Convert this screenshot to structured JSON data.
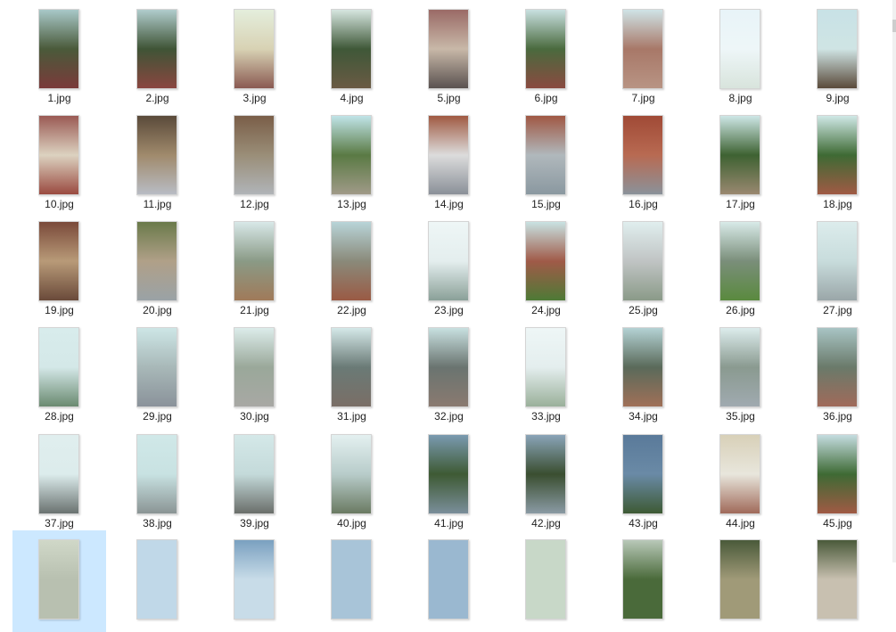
{
  "files": [
    {
      "name": "1.jpg",
      "top": "#a8c8c8",
      "mid": "#4a5a3a",
      "bottom": "#7a3a3a"
    },
    {
      "name": "2.jpg",
      "top": "#b0cccc",
      "mid": "#3f5436",
      "bottom": "#8a4640"
    },
    {
      "name": "3.jpg",
      "top": "#e4eedc",
      "mid": "#d8d2b4",
      "bottom": "#8a5a52"
    },
    {
      "name": "4.jpg",
      "top": "#d6e6e0",
      "mid": "#3f5838",
      "bottom": "#6a5a44"
    },
    {
      "name": "5.jpg",
      "top": "#9a6a66",
      "mid": "#c8b8a8",
      "bottom": "#5a5250"
    },
    {
      "name": "6.jpg",
      "top": "#c8e0e0",
      "mid": "#4a6a3e",
      "bottom": "#8a4a40"
    },
    {
      "name": "7.jpg",
      "top": "#cfe3e6",
      "mid": "#a87868",
      "bottom": "#b89484"
    },
    {
      "name": "8.jpg",
      "top": "#e8f4f8",
      "mid": "#eef6f8",
      "bottom": "#d8e4dc"
    },
    {
      "name": "9.jpg",
      "top": "#c8e2e6",
      "mid": "#cfe4e4",
      "bottom": "#5a4a3a"
    },
    {
      "name": "10.jpg",
      "top": "#9a5a54",
      "mid": "#dcd2c0",
      "bottom": "#9a4a40"
    },
    {
      "name": "11.jpg",
      "top": "#5a4a3a",
      "mid": "#a08a6c",
      "bottom": "#b8bcc4"
    },
    {
      "name": "12.jpg",
      "top": "#7a5e48",
      "mid": "#9a8e78",
      "bottom": "#b0b4b8"
    },
    {
      "name": "13.jpg",
      "top": "#c0e4e8",
      "mid": "#5a7a44",
      "bottom": "#a09a88"
    },
    {
      "name": "14.jpg",
      "top": "#a05a42",
      "mid": "#dcdcdc",
      "bottom": "#8a9098"
    },
    {
      "name": "15.jpg",
      "top": "#a05844",
      "mid": "#b0b8bc",
      "bottom": "#8a98a0"
    },
    {
      "name": "16.jpg",
      "top": "#a04a36",
      "mid": "#b86a52",
      "bottom": "#8a929a"
    },
    {
      "name": "17.jpg",
      "top": "#cde6e6",
      "mid": "#3e6232",
      "bottom": "#9a8870"
    },
    {
      "name": "18.jpg",
      "top": "#cfe8e6",
      "mid": "#3e6a34",
      "bottom": "#a05a44"
    },
    {
      "name": "19.jpg",
      "top": "#7a4a3a",
      "mid": "#b89a78",
      "bottom": "#6a4a3a"
    },
    {
      "name": "20.jpg",
      "top": "#6a7a4a",
      "mid": "#b0a088",
      "bottom": "#9aa2a6"
    },
    {
      "name": "21.jpg",
      "top": "#d8e8e8",
      "mid": "#8a9a86",
      "bottom": "#a07a5a"
    },
    {
      "name": "22.jpg",
      "top": "#b8d4d8",
      "mid": "#8a8a7a",
      "bottom": "#9a5a44"
    },
    {
      "name": "23.jpg",
      "top": "#eef6f6",
      "mid": "#e4eeee",
      "bottom": "#8aa098"
    },
    {
      "name": "24.jpg",
      "top": "#c8e2e2",
      "mid": "#a05a48",
      "bottom": "#4e7a36"
    },
    {
      "name": "25.jpg",
      "top": "#e0eeee",
      "mid": "#c0c4c4",
      "bottom": "#8a9a88"
    },
    {
      "name": "26.jpg",
      "top": "#d8eae8",
      "mid": "#7a8e7a",
      "bottom": "#5a8a3e"
    },
    {
      "name": "27.jpg",
      "top": "#dcecec",
      "mid": "#c8dcdc",
      "bottom": "#9aa6a8"
    },
    {
      "name": "28.jpg",
      "top": "#d8ecec",
      "mid": "#d4e8e8",
      "bottom": "#6a8a70"
    },
    {
      "name": "29.jpg",
      "top": "#cde6e6",
      "mid": "#a8b8b8",
      "bottom": "#8a929a"
    },
    {
      "name": "30.jpg",
      "top": "#dcecea",
      "mid": "#9aa89a",
      "bottom": "#a8a8a4"
    },
    {
      "name": "31.jpg",
      "top": "#d4e8e8",
      "mid": "#6a7a76",
      "bottom": "#7a6e66"
    },
    {
      "name": "32.jpg",
      "top": "#c8e0e0",
      "mid": "#6a7470",
      "bottom": "#8a7a70"
    },
    {
      "name": "33.jpg",
      "top": "#eef6f6",
      "mid": "#e4eeee",
      "bottom": "#9ab09a"
    },
    {
      "name": "34.jpg",
      "top": "#b4d2d4",
      "mid": "#5a6a5a",
      "bottom": "#a07058"
    },
    {
      "name": "35.jpg",
      "top": "#dcecec",
      "mid": "#8a9a90",
      "bottom": "#a0aab0"
    },
    {
      "name": "36.jpg",
      "top": "#a8c4c4",
      "mid": "#6a7a6a",
      "bottom": "#a06a5a"
    },
    {
      "name": "37.jpg",
      "top": "#e0eeee",
      "mid": "#dcecec",
      "bottom": "#6a7270"
    },
    {
      "name": "38.jpg",
      "top": "#d0e8e8",
      "mid": "#c8e2e2",
      "bottom": "#8a9494"
    },
    {
      "name": "39.jpg",
      "top": "#d4e8e8",
      "mid": "#c4dada",
      "bottom": "#6a6e6a"
    },
    {
      "name": "40.jpg",
      "top": "#e4f0f0",
      "mid": "#b8ccca",
      "bottom": "#6a7a62"
    },
    {
      "name": "41.jpg",
      "top": "#7a9ab0",
      "mid": "#3e5a34",
      "bottom": "#7a8e9a"
    },
    {
      "name": "42.jpg",
      "top": "#8aa4b8",
      "mid": "#3a4e30",
      "bottom": "#8a9aa4"
    },
    {
      "name": "43.jpg",
      "top": "#5a7a9a",
      "mid": "#6a8aa6",
      "bottom": "#3e5a34"
    },
    {
      "name": "44.jpg",
      "top": "#d8d0b8",
      "mid": "#e8e6dc",
      "bottom": "#a06a5a"
    },
    {
      "name": "45.jpg",
      "top": "#c4dce0",
      "mid": "#3e6a34",
      "bottom": "#a05a44"
    },
    {
      "name": "",
      "top": "#d0d8c8",
      "mid": "#b8c0b0",
      "bottom": "#b8c0b0",
      "selected": true
    },
    {
      "name": "",
      "top": "#c0d8e8",
      "mid": "#c0d8e8",
      "bottom": "#c0d8e8"
    },
    {
      "name": "",
      "top": "#7aa0c0",
      "mid": "#c8dce8",
      "bottom": "#c8dce8"
    },
    {
      "name": "",
      "top": "#a8c4d8",
      "mid": "#a8c4d8",
      "bottom": "#a8c4d8"
    },
    {
      "name": "",
      "top": "#9ab8d0",
      "mid": "#9ab8d0",
      "bottom": "#9ab8d0"
    },
    {
      "name": "",
      "top": "#c8d8c8",
      "mid": "#c8d8c8",
      "bottom": "#c8d8c8"
    },
    {
      "name": "",
      "top": "#b8c8b8",
      "mid": "#4a6a3a",
      "bottom": "#4a6a3a"
    },
    {
      "name": "",
      "top": "#4a5a3a",
      "mid": "#a09a78",
      "bottom": "#a09a78"
    },
    {
      "name": "",
      "top": "#4a5a3a",
      "mid": "#c8c0b0",
      "bottom": "#c8c0b0"
    }
  ],
  "colors": {
    "selection": "#cce8ff",
    "label_text": "#1f1f1f"
  }
}
